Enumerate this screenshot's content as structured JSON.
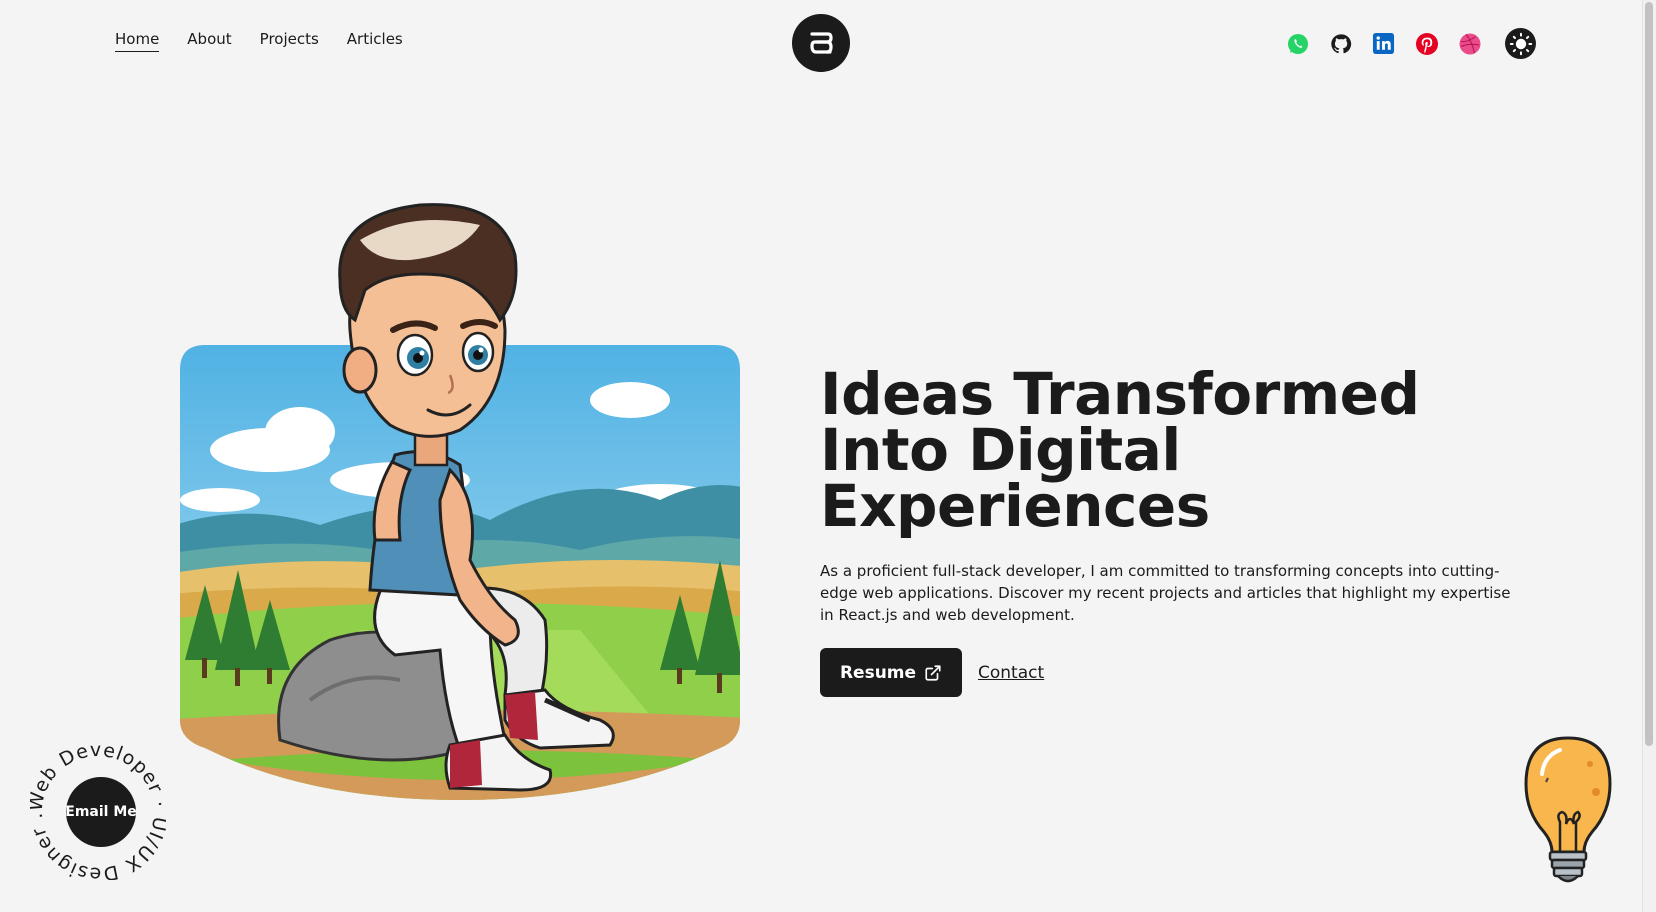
{
  "nav": {
    "home": "Home",
    "about": "About",
    "projects": "Projects",
    "articles": "Articles"
  },
  "logo": {
    "icon": "s-b-monogram-logo"
  },
  "socials": [
    {
      "name": "whatsapp-icon",
      "color": "#25d366"
    },
    {
      "name": "github-icon",
      "color": "#1b1b1b"
    },
    {
      "name": "linkedin-icon",
      "color": "#0a66c2"
    },
    {
      "name": "pinterest-icon",
      "color": "#e60023"
    },
    {
      "name": "dribbble-icon",
      "color": "#ea4c89"
    }
  ],
  "theme_toggle": {
    "icon": "sun-icon"
  },
  "hero": {
    "headline": "Ideas Transformed Into Digital Experiences",
    "intro": "As a proficient full-stack developer, I am committed to transforming concepts into cutting-edge web applications. Discover my recent projects and articles that highlight my expertise in React.js and web development.",
    "resume_label": "Resume",
    "contact_label": "Contact"
  },
  "email_badge": {
    "label": "Email Me",
    "ring_text": "Web Developer · UI/UX Designer ."
  },
  "colors": {
    "accent": "#1b1b1b",
    "background": "#f4f4f4"
  }
}
